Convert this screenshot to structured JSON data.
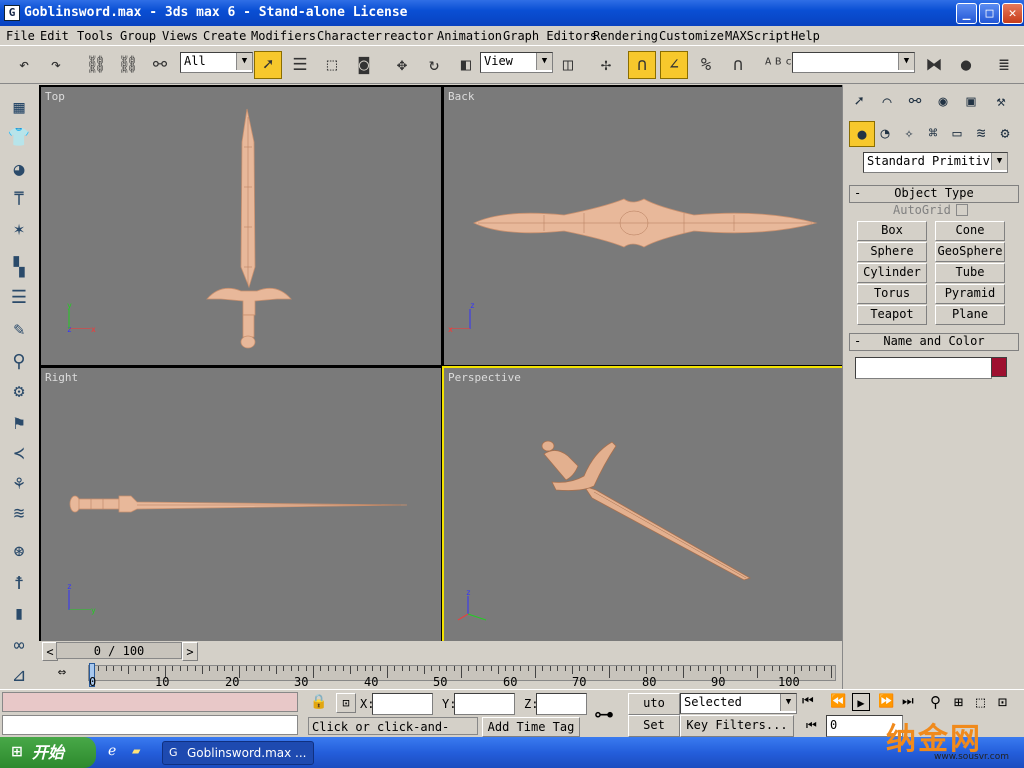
{
  "window": {
    "title": "Goblinsword.max - 3ds max 6 - Stand-alone License",
    "minimize": "_",
    "maximize": "□",
    "close": "✕"
  },
  "menu": [
    "File",
    "Edit",
    "Tools",
    "Group",
    "Views",
    "Create",
    "Modifiers",
    "Character",
    "reactor",
    "Animation",
    "Graph Editors",
    "Rendering",
    "Customize",
    "MAXScript",
    "Help"
  ],
  "toolbar": {
    "selection_filter": "All",
    "reference_coord": "View",
    "named_selection": ""
  },
  "viewports": {
    "top": "Top",
    "back": "Back",
    "right": "Right",
    "perspective": "Perspective",
    "axis_x": "x",
    "axis_y": "y",
    "axis_z": "z"
  },
  "command_panel": {
    "category": "Standard Primitiv",
    "object_type_title": "Object Type",
    "autogrid": "AutoGrid",
    "buttons": [
      "Box",
      "Cone",
      "Sphere",
      "GeoSphere",
      "Cylinder",
      "Tube",
      "Torus",
      "Pyramid",
      "Teapot",
      "Plane"
    ],
    "name_color_title": "Name and Color",
    "object_name": "",
    "color": "#9e1030",
    "minus": "-"
  },
  "timeline": {
    "frame_display": "0 / 100",
    "prev": "<",
    "next": ">",
    "ticks": [
      "0",
      "10",
      "20",
      "30",
      "40",
      "50",
      "60",
      "70",
      "80",
      "90",
      "100"
    ]
  },
  "status": {
    "x_label": "X:",
    "y_label": "Y:",
    "z_label": "Z:",
    "x_value": "",
    "y_value": "",
    "z_value": "",
    "prompt": "Click or click-and-drag",
    "add_time_tag": "Add Time Tag",
    "auto_key": "uto Key",
    "set_key": "Set Key",
    "key_mode": "Selected",
    "key_filters": "Key Filters...",
    "current_frame": "0"
  },
  "taskbar": {
    "start": "开始",
    "task": "Goblinsword.max ..."
  },
  "watermark": {
    "text": "纳金网",
    "url": "www.sousvr.com"
  }
}
